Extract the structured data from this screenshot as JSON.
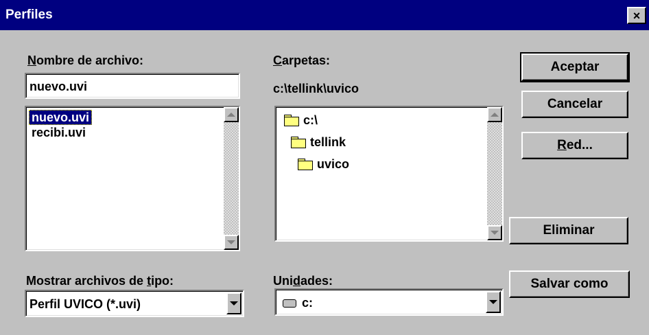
{
  "window": {
    "title": "Perfiles",
    "close_glyph": "×"
  },
  "filename": {
    "label": "Nombre de archivo:",
    "value": "nuevo.uvi",
    "files": [
      "nuevo.uvi",
      "recibi.uvi"
    ],
    "selected_index": 0
  },
  "folders": {
    "label": "Carpetas:",
    "current_path": "c:\\tellink\\uvico",
    "tree": [
      "c:\\",
      "tellink",
      "uvico"
    ]
  },
  "filetype": {
    "label": "Mostrar archivos de tipo:",
    "value": "Perfil UVICO (*.uvi)"
  },
  "drives": {
    "label": "Unidades:",
    "value": "c:"
  },
  "buttons": {
    "accept": "Aceptar",
    "cancel": "Cancelar",
    "network": "Red...",
    "delete": "Eliminar",
    "save_as": "Salvar como"
  },
  "colors": {
    "title_bar": "#000080",
    "face": "#c0c0c0",
    "selection": "#000080",
    "folder": "#ffff80"
  }
}
